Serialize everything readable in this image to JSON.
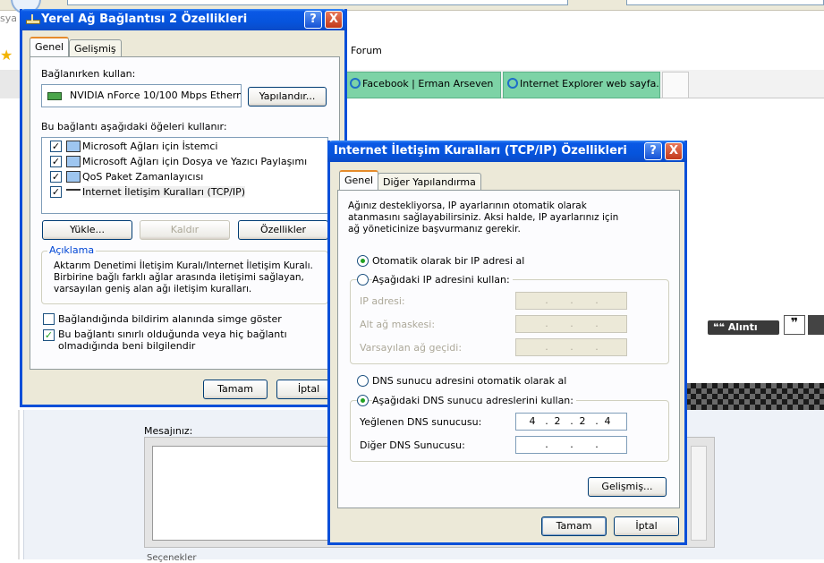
{
  "background": {
    "menu_fragment": "sya",
    "forum_link": "Forum",
    "tabs": [
      {
        "label": "Facebook | Erman Arseven"
      },
      {
        "label": "Internet Explorer web sayfa..."
      }
    ],
    "quote_button": "Alıntı",
    "message_label": "Mesajınız:",
    "bottom_fragment": "Seçenekler"
  },
  "conn_dialog": {
    "title": "Yerel Ağ Bağlantısı 2 Özellikleri",
    "help_btn": "?",
    "close_btn": "X",
    "tabs": [
      "Genel",
      "Gelişmiş"
    ],
    "connect_using_label": "Bağlanırken kullan:",
    "adapter_name": "NVIDIA nForce 10/100 Mbps Ethern",
    "configure_btn": "Yapılandır...",
    "items_label": "Bu bağlantı aşağıdaki öğeleri kullanır:",
    "items": [
      {
        "label": "Microsoft Ağları için İstemci",
        "checked": true
      },
      {
        "label": "Microsoft Ağları için Dosya ve Yazıcı Paylaşımı",
        "checked": true
      },
      {
        "label": "QoS Paket Zamanlayıcısı",
        "checked": true
      },
      {
        "label": "Internet İletişim Kuralları (TCP/IP)",
        "checked": true
      }
    ],
    "install_btn": "Yükle...",
    "uninstall_btn": "Kaldır",
    "properties_btn": "Özellikler",
    "description_title": "Açıklama",
    "description_text": "Aktarım Denetimi İletişim Kuralı/Internet İletişim Kuralı. Birbirine bağlı farklı ağlar arasında iletişimi sağlayan, varsayılan geniş alan ağı iletişim kuralları.",
    "show_icon_label": "Bağlandığında bildirim alanında simge göster",
    "notify_label": "Bu bağlantı sınırlı olduğunda veya hiç bağlantı olmadığında beni bilgilendir",
    "ok_btn": "Tamam",
    "cancel_btn": "İptal"
  },
  "tcpip_dialog": {
    "title": "Internet İletişim Kuralları (TCP/IP) Özellikleri",
    "help_btn": "?",
    "close_btn": "X",
    "tabs": [
      "Genel",
      "Diğer Yapılandırma"
    ],
    "intro": "Ağınız destekliyorsa, IP ayarlarının otomatik olarak atanmasını sağlayabilirsiniz. Aksi halde, IP ayarlarınız için ağ yöneticinize başvurmanız gerekir.",
    "auto_ip_label": "Otomatik olarak bir IP adresi al",
    "manual_ip_label": "Aşağıdaki IP adresini kullan:",
    "ip_label": "IP adresi:",
    "subnet_label": "Alt ağ maskesi:",
    "gateway_label": "Varsayılan ağ geçidi:",
    "auto_dns_label": "DNS sunucu adresini otomatik olarak al",
    "manual_dns_label": "Aşağıdaki DNS sunucu adreslerini kullan:",
    "preferred_dns_label": "Yeğlenen DNS sunucusu:",
    "preferred_dns": [
      "4",
      "2",
      "2",
      "4"
    ],
    "alternate_dns_label": "Diğer DNS Sunucusu:",
    "advanced_btn": "Gelişmiş...",
    "ok_btn": "Tamam",
    "cancel_btn": "İptal",
    "ip_mode": "auto",
    "dns_mode": "manual"
  }
}
